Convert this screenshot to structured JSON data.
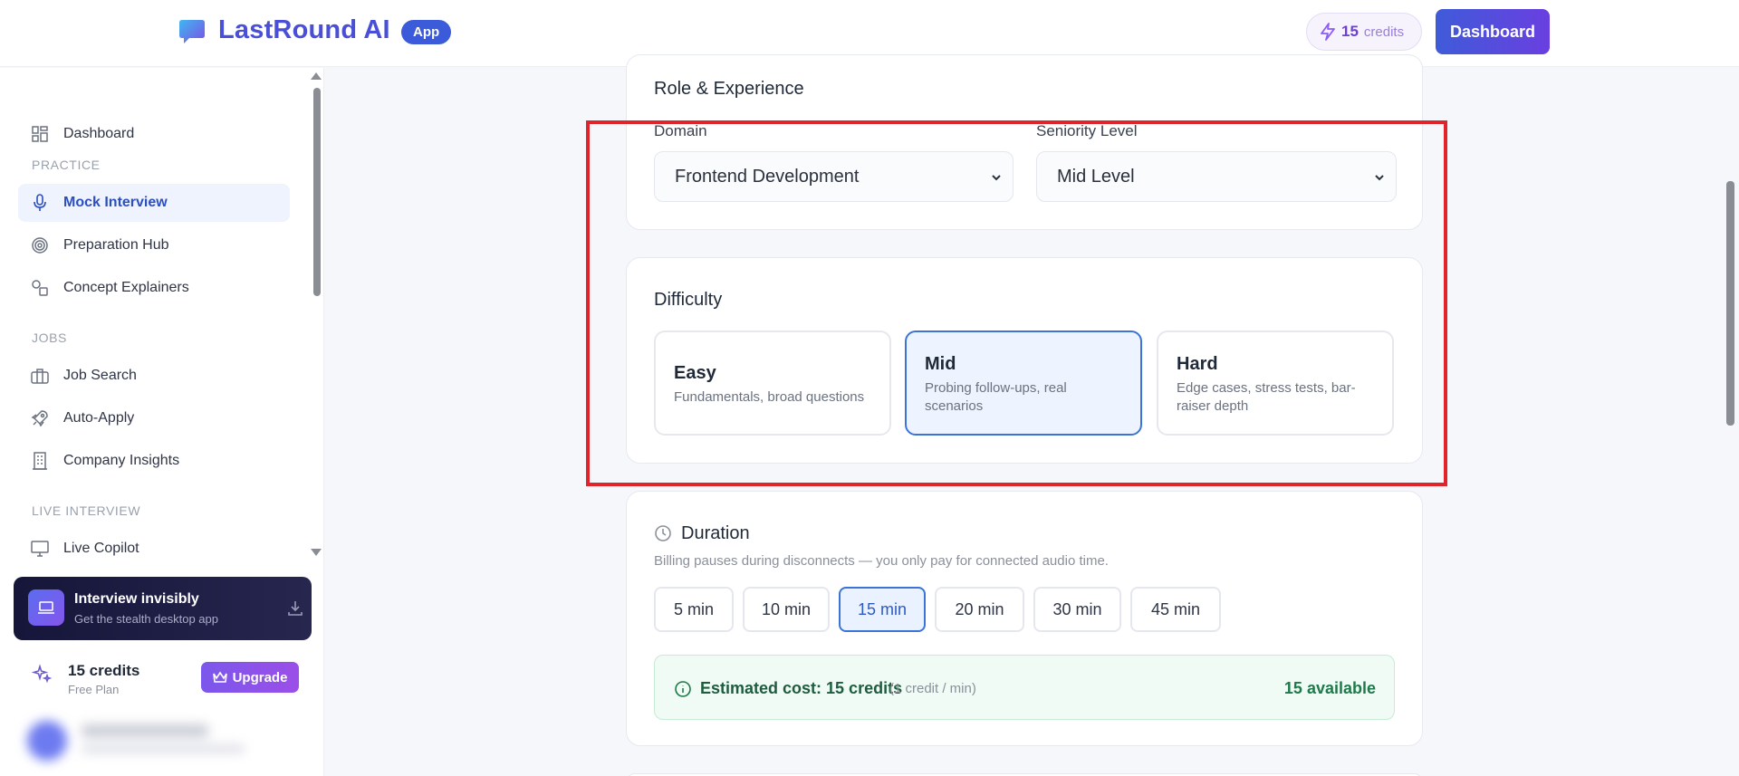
{
  "header": {
    "brand": "LastRound AI",
    "badge": "App",
    "credits_count": "15",
    "credits_label": "credits",
    "dashboard_button": "Dashboard"
  },
  "sidebar": {
    "dashboard": "Dashboard",
    "sections": {
      "practice": "PRACTICE",
      "jobs": "JOBS",
      "live": "LIVE INTERVIEW"
    },
    "items": {
      "mock_interview": "Mock Interview",
      "preparation_hub": "Preparation Hub",
      "concept_explainers": "Concept Explainers",
      "job_search": "Job Search",
      "auto_apply": "Auto-Apply",
      "company_insights": "Company Insights",
      "live_copilot": "Live Copilot"
    },
    "promo": {
      "title": "Interview invisibly",
      "subtitle": "Get the stealth desktop app"
    },
    "credits": {
      "count": "15 credits",
      "plan": "Free Plan",
      "upgrade": "Upgrade"
    }
  },
  "role": {
    "title": "Role & Experience",
    "domain_label": "Domain",
    "domain_value": "Frontend Development",
    "seniority_label": "Seniority Level",
    "seniority_value": "Mid Level"
  },
  "difficulty": {
    "title": "Difficulty",
    "options": [
      {
        "name": "Easy",
        "desc": "Fundamentals, broad questions"
      },
      {
        "name": "Mid",
        "desc": "Probing follow-ups, real scenarios"
      },
      {
        "name": "Hard",
        "desc": "Edge cases, stress tests, bar-raiser depth"
      }
    ],
    "selected": "Mid"
  },
  "duration": {
    "title": "Duration",
    "note": "Billing pauses during disconnects — you only pay for connected audio time.",
    "options": [
      "5 min",
      "10 min",
      "15 min",
      "20 min",
      "30 min",
      "45 min"
    ],
    "selected": "15 min",
    "estimate": "Estimated cost: 15 credits",
    "rate": "(1 credit / min)",
    "available": "15 available"
  },
  "colors": {
    "accent": "#3b5bdb",
    "selected_border": "#3b74d6",
    "highlight": "#e0242b",
    "success_bg": "#effbf4"
  }
}
